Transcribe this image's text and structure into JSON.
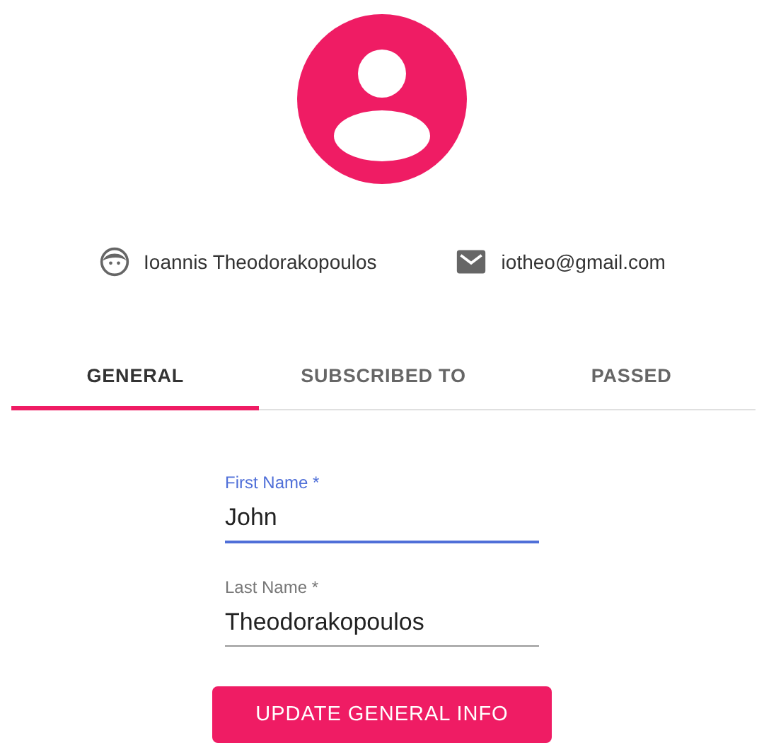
{
  "profile": {
    "name": "Ioannis Theodorakopoulos",
    "email": "iotheo@gmail.com"
  },
  "tabs": [
    {
      "label": "GENERAL",
      "selected": true
    },
    {
      "label": "SUBSCRIBED TO",
      "selected": false
    },
    {
      "label": "PASSED",
      "selected": false
    }
  ],
  "fields": [
    {
      "label": "First Name *",
      "value": "John",
      "focused": true
    },
    {
      "label": "Last Name *",
      "value": "Theodorakopoulos",
      "focused": false
    }
  ],
  "button": "UPDATE GENERAL INFO"
}
